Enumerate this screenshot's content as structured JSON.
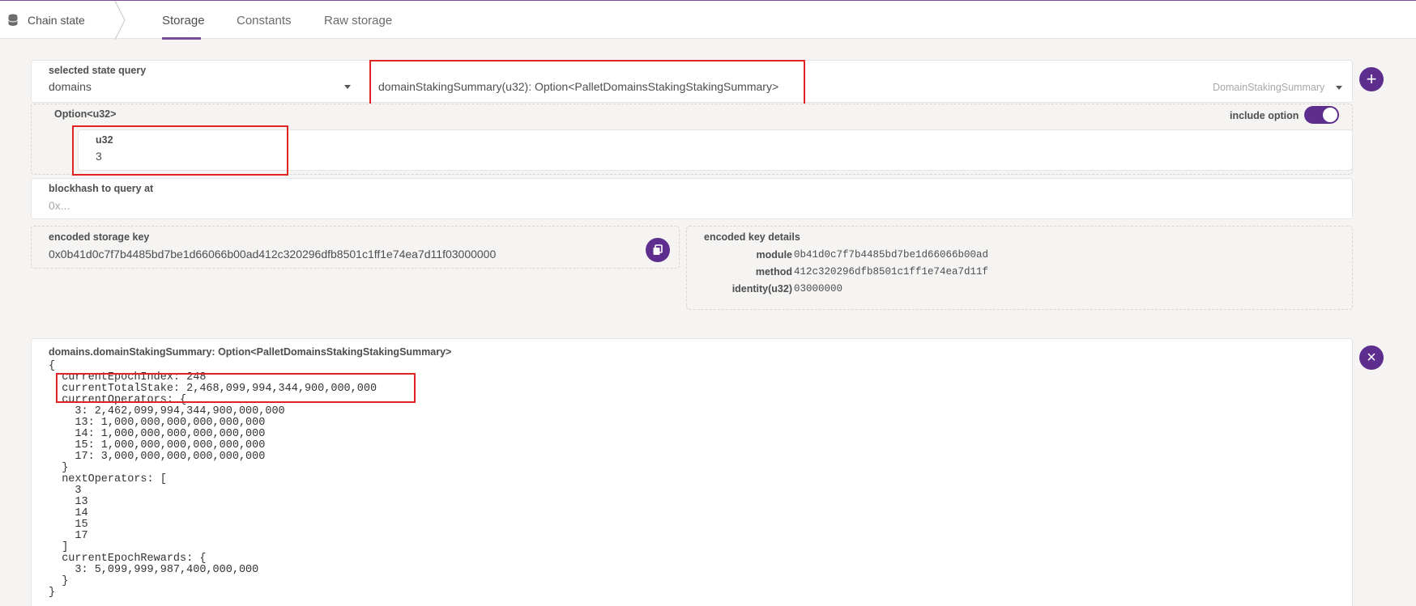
{
  "nav": {
    "section": "Chain state",
    "tabs": [
      {
        "label": "Storage"
      },
      {
        "label": "Constants"
      },
      {
        "label": "Raw storage"
      }
    ]
  },
  "query": {
    "selected_label": "selected state query",
    "module": "domains",
    "method": "domainStakingSummary(u32): Option<PalletDomainsStakingStakingSummary>",
    "method_short": "DomainStakingSummary",
    "param_label": "Option<u32>",
    "include_option_label": "include option",
    "param_type": "u32",
    "param_value": "3",
    "blockhash_label": "blockhash to query at",
    "blockhash_placeholder": "0x..."
  },
  "encoded": {
    "key_label": "encoded storage key",
    "key_value": "0x0b41d0c7f7b4485bd7be1d66066b00ad412c320296dfb8501c1ff1e74ea7d11f03000000",
    "details_label": "encoded key details",
    "details": [
      {
        "label": "module",
        "value": "0b41d0c7f7b4485bd7be1d66066b00ad"
      },
      {
        "label": "method",
        "value": "412c320296dfb8501c1ff1e74ea7d11f"
      },
      {
        "label": "identity(u32)",
        "value": "03000000"
      }
    ]
  },
  "result": {
    "title": "domains.domainStakingSummary: Option<PalletDomainsStakingStakingSummary>",
    "lines": [
      "{",
      "  currentEpochIndex: 248",
      "  currentTotalStake: 2,468,099,994,344,900,000,000",
      "  currentOperators: {",
      "    3: 2,462,099,994,344,900,000,000",
      "    13: 1,000,000,000,000,000,000",
      "    14: 1,000,000,000,000,000,000",
      "    15: 1,000,000,000,000,000,000",
      "    17: 3,000,000,000,000,000,000",
      "  }",
      "  nextOperators: [",
      "    3",
      "    13",
      "    14",
      "    15",
      "    17",
      "  ]",
      "  currentEpochRewards: {",
      "    3: 5,099,999,987,400,000,000",
      "  }",
      "}"
    ]
  },
  "buttons": {
    "add": "+",
    "close": "×"
  },
  "colors": {
    "accent": "#5e2e8e",
    "highlight": "#e02424"
  }
}
